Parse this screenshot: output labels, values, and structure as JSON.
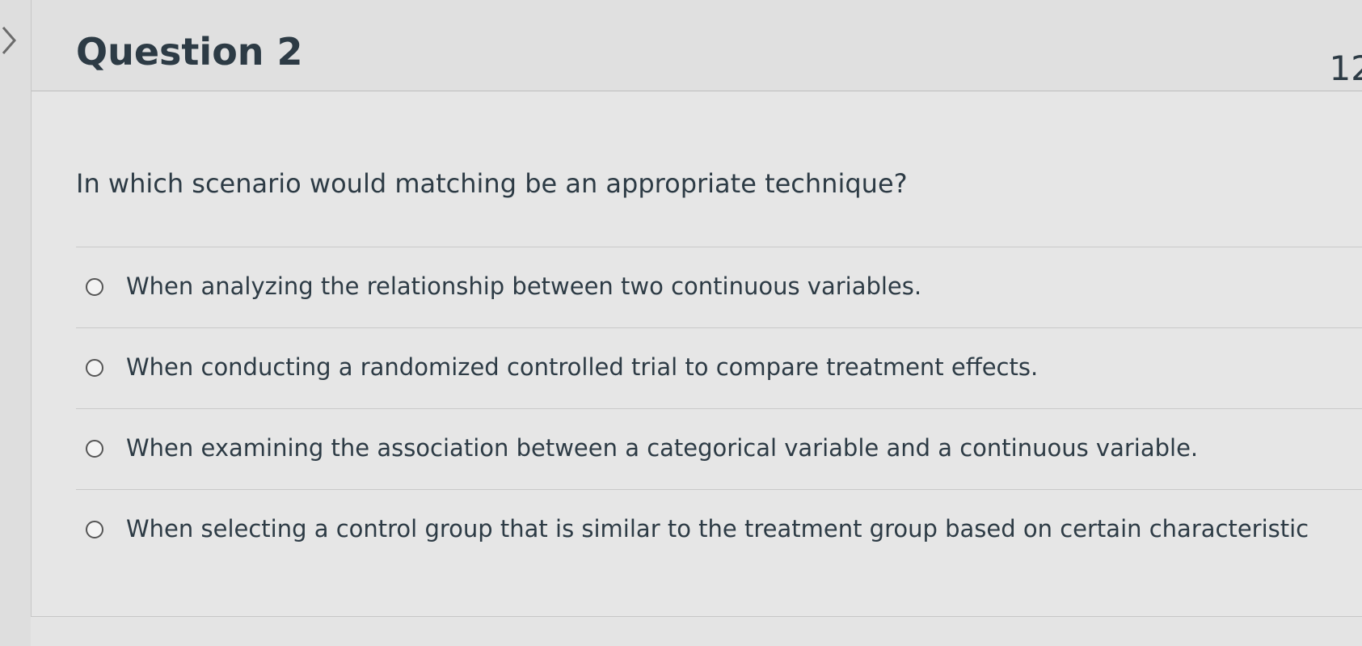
{
  "question": {
    "title": "Question 2",
    "points": "12",
    "text": "In which scenario would matching be an appropriate technique?",
    "answers": [
      {
        "label": "When analyzing the relationship between two continuous variables."
      },
      {
        "label": "When conducting a randomized controlled trial to compare treatment effects."
      },
      {
        "label": "When examining the association between a categorical variable and a continuous variable."
      },
      {
        "label": "When selecting a control group that is similar to the treatment group based on certain characteristic"
      }
    ]
  },
  "icons": {
    "nav": "chevron-right-icon",
    "answer_marker": "radio-unselected-icon"
  },
  "colors": {
    "text": "#2d3b45",
    "background": "#e4e4e4",
    "divider": "#c9c9c9"
  }
}
